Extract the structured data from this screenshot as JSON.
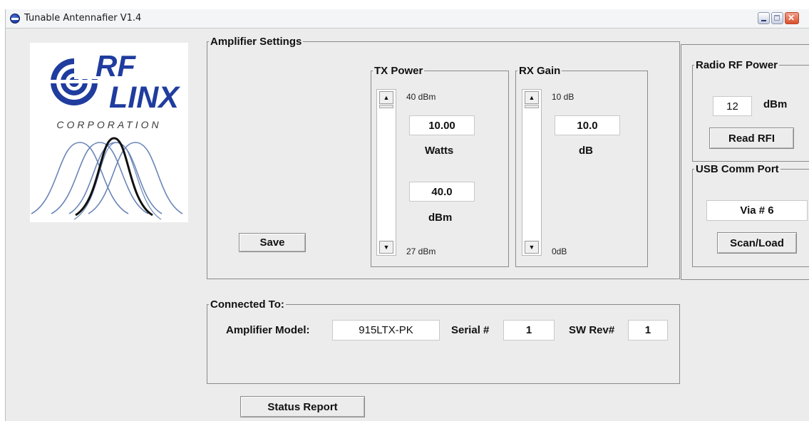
{
  "window": {
    "title": "Tunable Antennafier V1.4"
  },
  "logo": {
    "line1": "RF",
    "line2": "LINX",
    "tagline": "CORPORATION"
  },
  "amplifier_settings": {
    "title": "Amplifier Settings",
    "save_label": "Save",
    "tx_power": {
      "title": "TX Power",
      "max_label": "40 dBm",
      "min_label": "27 dBm",
      "watts_value": "10.00",
      "watts_unit": "Watts",
      "dbm_value": "40.0",
      "dbm_unit": "dBm",
      "slider_level": 1.0
    },
    "rx_gain": {
      "title": "RX Gain",
      "max_label": "10 dB",
      "min_label": "0dB",
      "value": "10.0",
      "unit": "dB",
      "slider_level": 1.0
    }
  },
  "radio_rf_power": {
    "title": "Radio RF Power",
    "value": "12",
    "unit": "dBm",
    "read_label": "Read RFI"
  },
  "usb_comm_port": {
    "title": "USB Comm Port",
    "value": "Via # 6",
    "scan_label": "Scan/Load"
  },
  "connected_to": {
    "title": "Connected To:",
    "model_label": "Amplifier Model:",
    "model_value": "915LTX-PK",
    "serial_label": "Serial #",
    "serial_value": "1",
    "swrev_label": "SW Rev#",
    "swrev_value": "1"
  },
  "status_report_label": "Status Report",
  "colors": {
    "logo_blue": "#1f3c9e",
    "window_bg": "#ececec"
  }
}
